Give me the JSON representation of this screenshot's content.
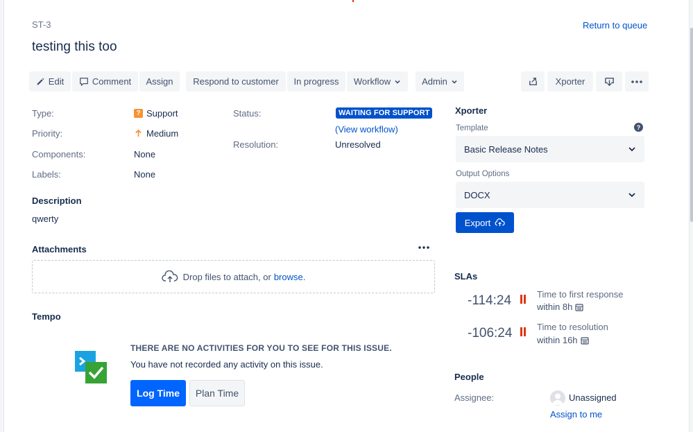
{
  "issue": {
    "key": "ST-3",
    "title": "testing this too",
    "return_link": "Return to queue"
  },
  "toolbar": {
    "edit": "Edit",
    "comment": "Comment",
    "assign": "Assign",
    "respond": "Respond to customer",
    "in_progress": "In progress",
    "workflow": "Workflow",
    "admin": "Admin",
    "xporter": "Xporter"
  },
  "details": {
    "type_label": "Type:",
    "type_value": "Support",
    "priority_label": "Priority:",
    "priority_value": "Medium",
    "components_label": "Components:",
    "components_value": "None",
    "labels_label": "Labels:",
    "labels_value": "None",
    "status_label": "Status:",
    "status_value": "WAITING FOR SUPPORT",
    "view_workflow": "(View workflow)",
    "resolution_label": "Resolution:",
    "resolution_value": "Unresolved"
  },
  "description": {
    "heading": "Description",
    "text": "qwerty"
  },
  "attachments": {
    "heading": "Attachments",
    "drop_text": "Drop files to attach, or",
    "browse": "browse."
  },
  "tempo": {
    "heading": "Tempo",
    "empty_title": "THERE ARE NO ACTIVITIES FOR YOU TO SEE FOR THIS ISSUE.",
    "empty_text": "You have not recorded any activity on this issue.",
    "log_time": "Log Time",
    "plan_time": "Plan Time"
  },
  "xporter_panel": {
    "heading": "Xporter",
    "template_label": "Template",
    "template_value": "Basic Release Notes",
    "output_label": "Output Options",
    "output_value": "DOCX",
    "export": "Export"
  },
  "slas": {
    "heading": "SLAs",
    "items": [
      {
        "time": "-114:24",
        "goal": "Time to first response",
        "within": "within 8h"
      },
      {
        "time": "-106:24",
        "goal": "Time to resolution",
        "within": "within 16h"
      }
    ]
  },
  "people": {
    "heading": "People",
    "assignee_label": "Assignee:",
    "assignee_value": "Unassigned",
    "assign_to_me": "Assign to me"
  },
  "colors": {
    "primary": "#0052cc",
    "sla_breached": "#de350b",
    "support_type": "#f79232",
    "priority_medium": "#f79232"
  }
}
